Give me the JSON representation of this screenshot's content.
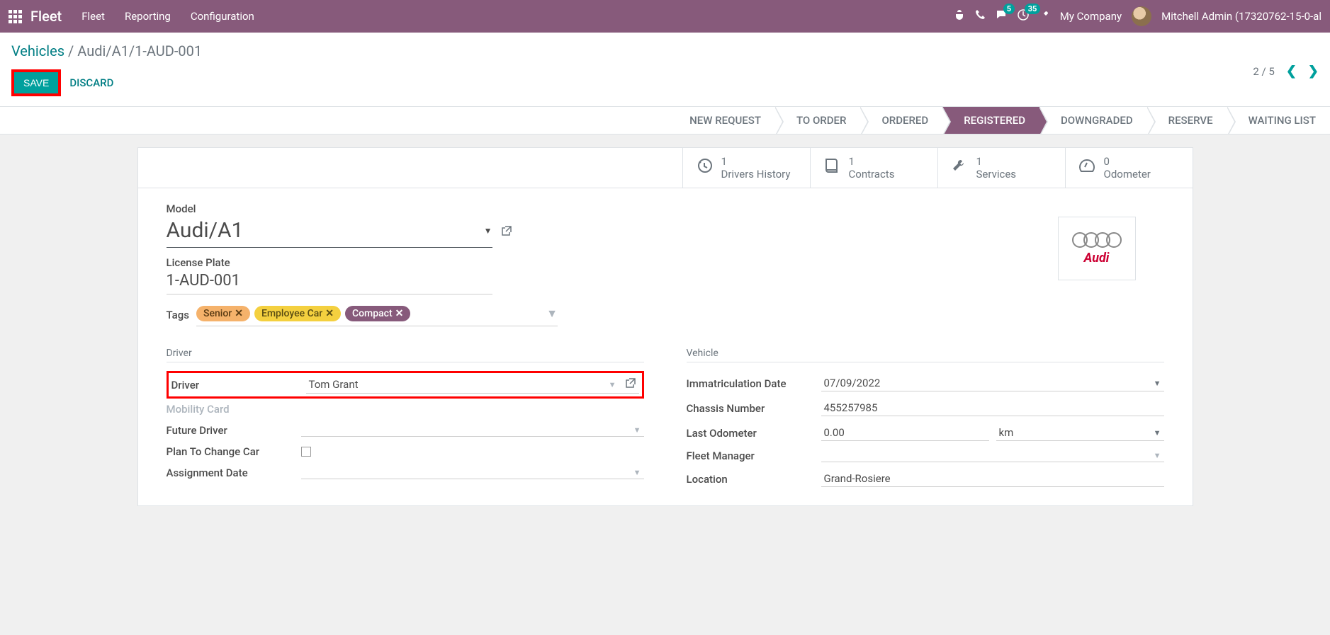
{
  "header": {
    "brand": "Fleet",
    "menu": [
      "Fleet",
      "Reporting",
      "Configuration"
    ],
    "msg_badge": "5",
    "clock_badge": "35",
    "company": "My Company",
    "user": "Mitchell Admin (17320762-15-0-al"
  },
  "breadcrumb": {
    "root": "Vehicles",
    "current": "Audi/A1/1-AUD-001"
  },
  "actions": {
    "save": "SAVE",
    "discard": "DISCARD"
  },
  "pager": {
    "text": "2 / 5"
  },
  "status": {
    "steps": [
      "NEW REQUEST",
      "TO ORDER",
      "ORDERED",
      "REGISTERED",
      "DOWNGRADED",
      "RESERVE",
      "WAITING LIST"
    ],
    "active_index": 3
  },
  "stat_buttons": [
    {
      "count": "1",
      "label": "Drivers History",
      "icon": "history"
    },
    {
      "count": "1",
      "label": "Contracts",
      "icon": "book"
    },
    {
      "count": "1",
      "label": "Services",
      "icon": "wrench"
    },
    {
      "count": "0",
      "label": "Odometer",
      "icon": "gauge"
    }
  ],
  "vehicle": {
    "model_label": "Model",
    "model": "Audi/A1",
    "plate_label": "License Plate",
    "plate": "1-AUD-001",
    "tags_label": "Tags",
    "tags": [
      {
        "text": "Senior",
        "bg": "#f5b26b",
        "fg": "#5a3b13"
      },
      {
        "text": "Employee Car",
        "bg": "#f4d03f",
        "fg": "#5a4d13"
      },
      {
        "text": "Compact",
        "bg": "#875a7b",
        "fg": "#ffffff"
      }
    ]
  },
  "driver_section": {
    "title": "Driver",
    "rows": {
      "driver_label": "Driver",
      "driver_value": "Tom Grant",
      "mobility_label": "Mobility Card",
      "future_label": "Future Driver",
      "plan_label": "Plan To Change Car",
      "assign_label": "Assignment Date"
    }
  },
  "vehicle_section": {
    "title": "Vehicle",
    "rows": {
      "imm_label": "Immatriculation Date",
      "imm_value": "07/09/2022",
      "chassis_label": "Chassis Number",
      "chassis_value": "455257985",
      "odo_label": "Last Odometer",
      "odo_value": "0.00",
      "odo_unit": "km",
      "mgr_label": "Fleet Manager",
      "loc_label": "Location",
      "loc_value": "Grand-Rosiere"
    }
  },
  "logo": {
    "text": "Audi"
  }
}
